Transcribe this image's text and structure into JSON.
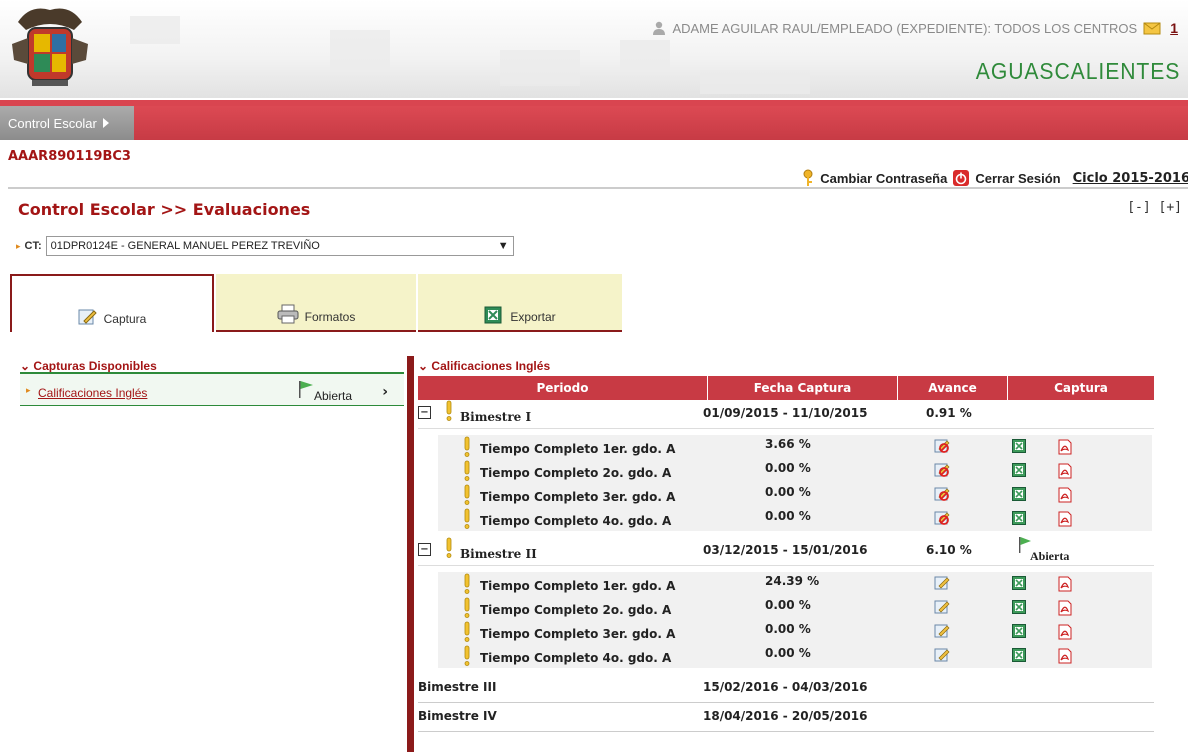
{
  "header": {
    "user_text": "ADAME AGUILAR RAUL/EMPLEADO (EXPEDIENTE): TODOS LOS CENTROS",
    "messages_count": "1",
    "city": "AGUASCALIENTES"
  },
  "nav": {
    "crumb": "Control Escolar"
  },
  "rfc": "AAAR890119BC3",
  "toplinks": {
    "change_password": "Cambiar Contraseña",
    "logout": "Cerrar Sesión",
    "cycle": "Ciclo 2015-2016"
  },
  "page": {
    "title": "Control Escolar >> Evaluaciones",
    "expand_controls": "[-] [+]",
    "ct_label": "CT:",
    "ct_value": "01DPR0124E - GENERAL MANUEL PEREZ TREVIÑO"
  },
  "tabs": [
    {
      "label": "Captura"
    },
    {
      "label": "Formatos"
    },
    {
      "label": "Exportar"
    }
  ],
  "left": {
    "header": "Capturas Disponibles",
    "item_label": "Calificaciones Inglés",
    "item_status": "Abierta"
  },
  "right": {
    "header": "Calificaciones Inglés",
    "columns": [
      "Periodo",
      "Fecha Captura",
      "Avance",
      "Captura"
    ],
    "bimestres": [
      {
        "name": "Bimestre I",
        "fecha": "01/09/2015 - 11/10/2015",
        "avance": "0.91 %",
        "status": "",
        "groups": [
          {
            "name": "Tiempo Completo 1er. gdo. A",
            "avance": "3.66 %"
          },
          {
            "name": "Tiempo Completo 2o. gdo. A",
            "avance": "0.00 %"
          },
          {
            "name": "Tiempo Completo 3er. gdo. A",
            "avance": "0.00 %"
          },
          {
            "name": "Tiempo Completo 4o. gdo. A",
            "avance": "0.00 %"
          }
        ]
      },
      {
        "name": "Bimestre II",
        "fecha": "03/12/2015 - 15/01/2016",
        "avance": "6.10 %",
        "status": "Abierta",
        "groups": [
          {
            "name": "Tiempo Completo 1er. gdo. A",
            "avance": "24.39 %"
          },
          {
            "name": "Tiempo Completo 2o. gdo. A",
            "avance": "0.00 %"
          },
          {
            "name": "Tiempo Completo 3er. gdo. A",
            "avance": "0.00 %"
          },
          {
            "name": "Tiempo Completo 4o. gdo. A",
            "avance": "0.00 %"
          }
        ]
      },
      {
        "name": "Bimestre III",
        "fecha": "15/02/2016 - 04/03/2016"
      },
      {
        "name": "Bimestre IV",
        "fecha": "18/04/2016 - 20/05/2016"
      }
    ]
  }
}
